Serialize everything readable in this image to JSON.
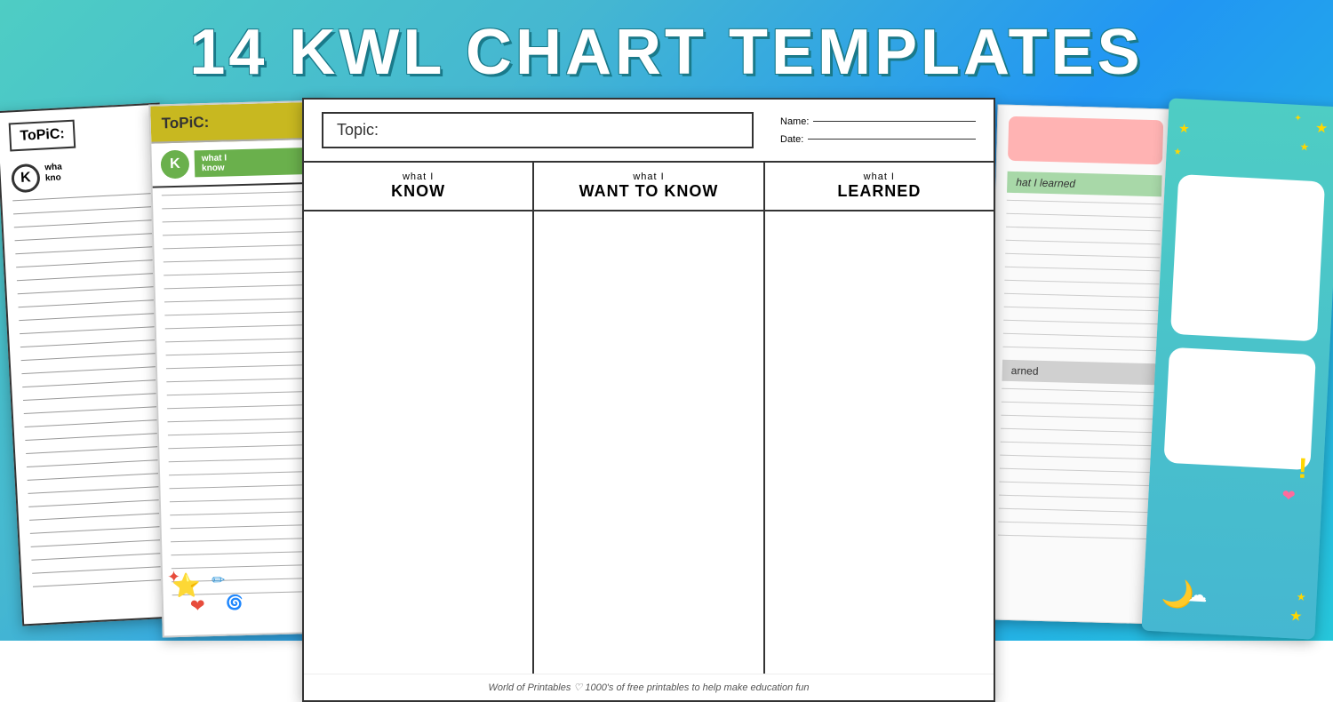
{
  "title": "14 KWL CHART TEMPLATES",
  "cards": {
    "farLeft": {
      "topicLabel": "ToPiC:",
      "kLabel": "wha\nkno"
    },
    "second": {
      "topicLabel": "ToPiC:",
      "kLabel": "what I\nknow"
    },
    "main": {
      "topicLabel": "Topic:",
      "nameLabel": "Name:",
      "dateLabel": "Date:",
      "col1Header": "what I",
      "col1Big": "KNOW",
      "col2Header": "what I",
      "col2Big": "WANT TO KNOW",
      "col3Header": "what I",
      "col3Big": "LEARNED",
      "footer": "World of Printables ♡  1000's of free printables to help make education fun"
    },
    "fourth": {
      "greenLabel": "hat I learned",
      "grayLabel": "arned"
    },
    "farRight": {
      "stars": "★ ★"
    }
  }
}
